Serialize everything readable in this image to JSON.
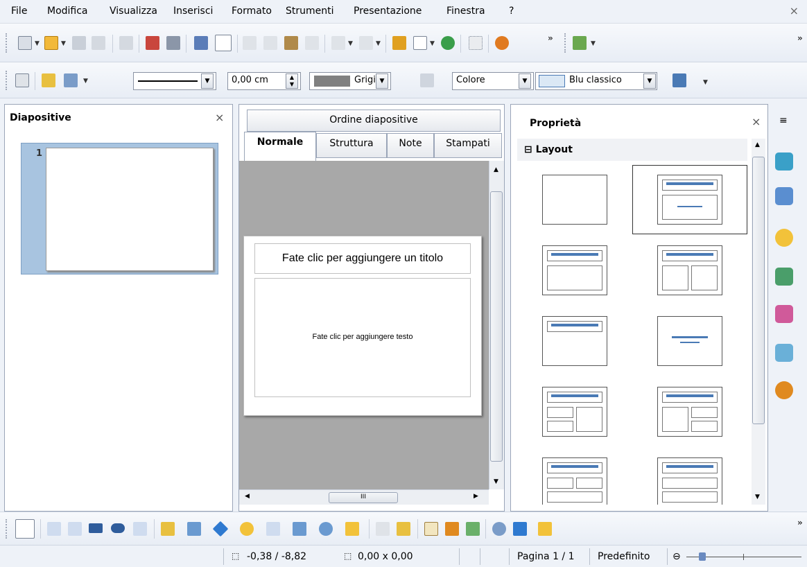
{
  "menu": {
    "items": [
      "File",
      "Modifica",
      "Visualizza",
      "Inserisci",
      "Formato",
      "Strumenti",
      "Presentazione",
      "Finestra",
      "?"
    ],
    "close": "×"
  },
  "toolbar2": {
    "line_width": "0,00 cm",
    "area_color_name": "Grigio",
    "fill_type": "Colore",
    "fill_color_name": "Blu classico"
  },
  "slides_panel": {
    "title": "Diapositive",
    "close": "×",
    "slide_number": "1"
  },
  "view_tabs": {
    "top": "Ordine diapositive",
    "tabs": [
      "Normale",
      "Struttura",
      "Note",
      "Stampati"
    ],
    "active": "Normale"
  },
  "slide": {
    "title_placeholder": "Fate clic per aggiungere un titolo",
    "text_placeholder": "Fate clic per aggiungere testo"
  },
  "scroll": {
    "hthumb": "III"
  },
  "properties": {
    "title": "Proprietà",
    "close": "×",
    "section_toggle": "⊟",
    "section_label": "Layout",
    "selected_layout_index": 1
  },
  "sidebar": {
    "menu_icon": "≡",
    "icons": [
      "properties-icon",
      "styles-icon",
      "gallery-icon",
      "animation-icon",
      "transition-icon",
      "master-slides-icon",
      "navigator-icon"
    ]
  },
  "statusbar": {
    "position": "-0,38 / -8,82",
    "size": "0,00 x 0,00",
    "page": "Pagina 1 / 1",
    "master": "Predefinito"
  },
  "colors": {
    "accent": "#4a7ab5",
    "grey_swatch": "#808080",
    "blue_swatch": "#dbe8f5"
  }
}
